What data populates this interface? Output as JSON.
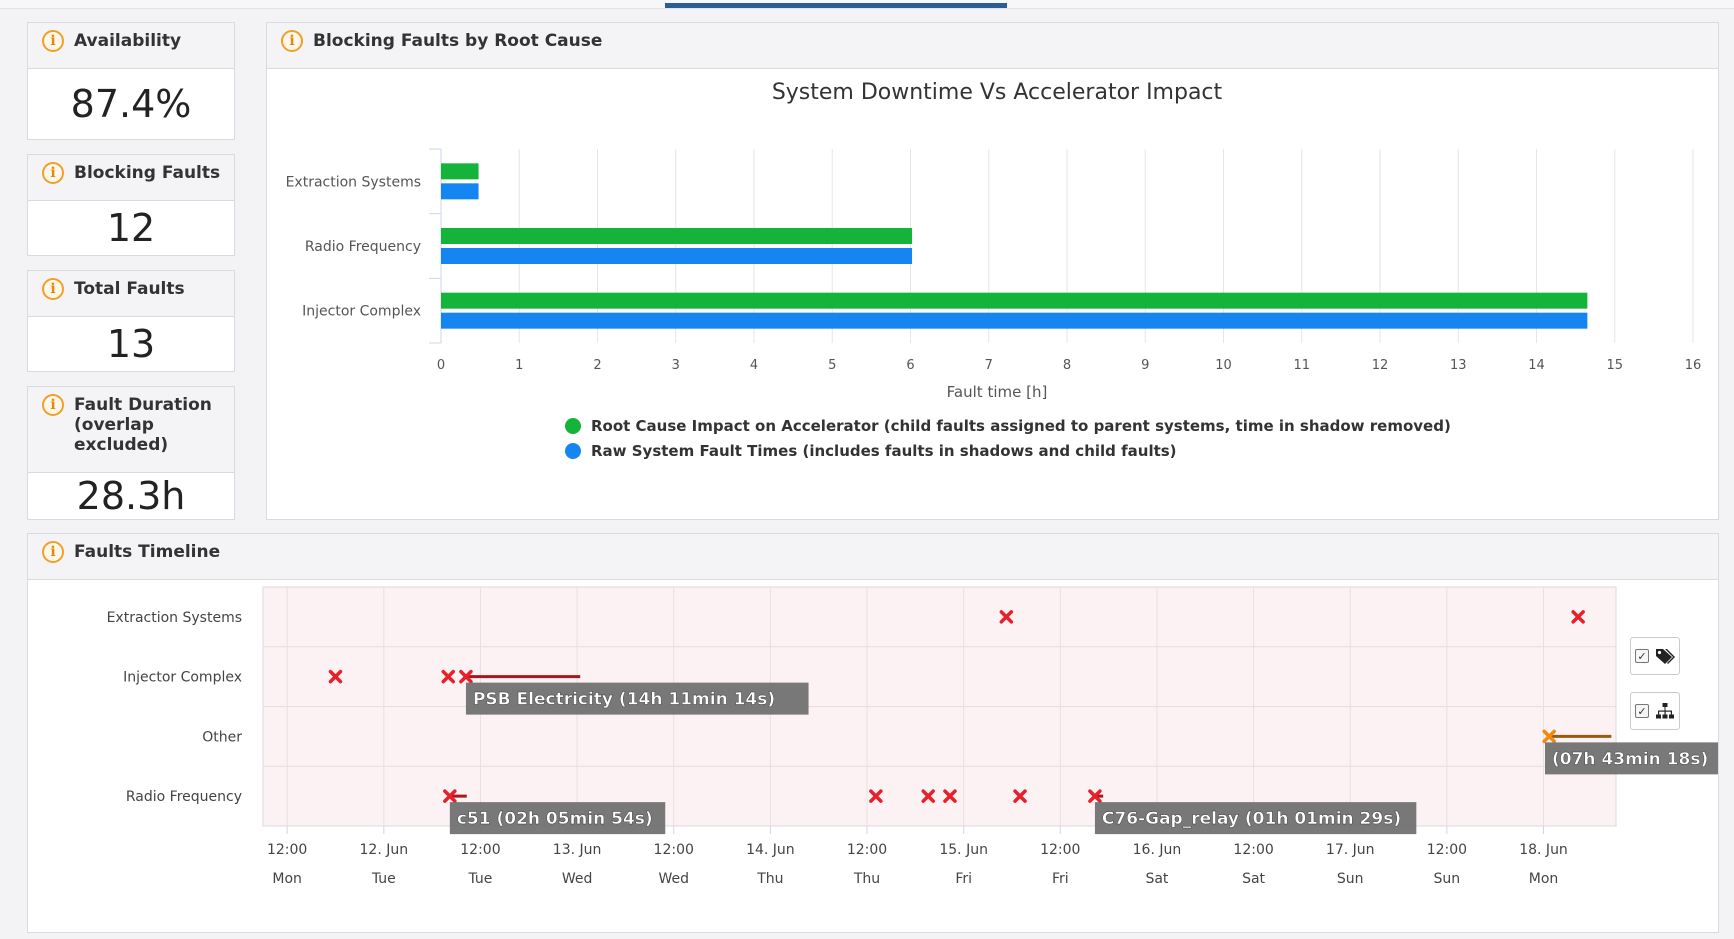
{
  "stats": [
    {
      "title": "Availability",
      "value": "87.4%"
    },
    {
      "title": "Blocking Faults",
      "value": "12"
    },
    {
      "title": "Total Faults",
      "value": "13"
    },
    {
      "title": "Fault Duration (overlap excluded)",
      "value": "28.3h"
    }
  ],
  "blocking_panel": {
    "title": "Blocking Faults by Root Cause"
  },
  "timeline_panel": {
    "title": "Faults Timeline"
  },
  "chart_data": [
    {
      "type": "bar",
      "orientation": "horizontal",
      "title": "System Downtime Vs Accelerator Impact",
      "xlabel": "Fault time [h]",
      "categories": [
        "Extraction Systems",
        "Radio Frequency",
        "Injector Complex"
      ],
      "xlim": [
        0,
        16
      ],
      "xticks": [
        0,
        1,
        2,
        3,
        4,
        5,
        6,
        7,
        8,
        9,
        10,
        11,
        12,
        13,
        14,
        15,
        16
      ],
      "series": [
        {
          "name": "Root Cause Impact on Accelerator (child faults assigned to parent systems, time in shadow removed)",
          "color": "#14b43a",
          "values": [
            0.48,
            6.02,
            14.65
          ]
        },
        {
          "name": "Raw System Fault Times (includes faults in shadows and child faults)",
          "color": "#1585f2",
          "values": [
            0.48,
            6.02,
            14.65
          ]
        }
      ],
      "legend": "bottom-center"
    },
    {
      "type": "scatter",
      "title": "",
      "categories": [
        "Extraction Systems",
        "Injector Complex",
        "Other",
        "Radio Frequency"
      ],
      "ticks": [
        {
          "top": "12:00",
          "bottom": "Mon"
        },
        {
          "top": "12. Jun",
          "bottom": "Tue"
        },
        {
          "top": "12:00",
          "bottom": "Tue"
        },
        {
          "top": "13. Jun",
          "bottom": "Wed"
        },
        {
          "top": "12:00",
          "bottom": "Wed"
        },
        {
          "top": "14. Jun",
          "bottom": "Thu"
        },
        {
          "top": "12:00",
          "bottom": "Thu"
        },
        {
          "top": "15. Jun",
          "bottom": "Fri"
        },
        {
          "top": "12:00",
          "bottom": "Fri"
        },
        {
          "top": "16. Jun",
          "bottom": "Sat"
        },
        {
          "top": "12:00",
          "bottom": "Sat"
        },
        {
          "top": "17. Jun",
          "bottom": "Sun"
        },
        {
          "top": "12:00",
          "bottom": "Sun"
        },
        {
          "top": "18. Jun",
          "bottom": "Mon"
        }
      ],
      "tick_hours": [
        -12,
        0,
        12,
        24,
        36,
        48,
        60,
        72,
        84,
        96,
        108,
        120,
        132,
        144
      ],
      "x_range_hours": [
        -15,
        153
      ],
      "x_unit": "hours from 12. Jun 00:00",
      "faults": [
        {
          "category": "Extraction Systems",
          "start": 77.3,
          "duration": 0,
          "color": "#e8202a"
        },
        {
          "category": "Extraction Systems",
          "start": 148.3,
          "duration": 0,
          "color": "#e8202a"
        },
        {
          "category": "Injector Complex",
          "start": -6.0,
          "duration": 0,
          "color": "#e8202a"
        },
        {
          "category": "Injector Complex",
          "start": 8.0,
          "duration": 0,
          "color": "#e8202a"
        },
        {
          "category": "Injector Complex",
          "start": 10.2,
          "duration": 14.19,
          "color": "#e8202a",
          "label": "PSB Electricity (14h 11min 14s)"
        },
        {
          "category": "Other",
          "start": 144.7,
          "duration": 7.72,
          "color": "#f08a10",
          "label": "(07h 43min 18s)"
        },
        {
          "category": "Radio Frequency",
          "start": 8.2,
          "duration": 2.1,
          "color": "#e8202a",
          "label": "c51 (02h 05min 54s)"
        },
        {
          "category": "Radio Frequency",
          "start": 61.1,
          "duration": 0,
          "color": "#e8202a"
        },
        {
          "category": "Radio Frequency",
          "start": 67.6,
          "duration": 0,
          "color": "#e8202a"
        },
        {
          "category": "Radio Frequency",
          "start": 70.3,
          "duration": 0,
          "color": "#e8202a"
        },
        {
          "category": "Radio Frequency",
          "start": 79.0,
          "duration": 0,
          "color": "#e8202a"
        },
        {
          "category": "Radio Frequency",
          "start": 88.3,
          "duration": 1.02,
          "color": "#e8202a",
          "label": "C76-Gap_relay (01h 01min 29s)"
        }
      ]
    }
  ],
  "colors": {
    "accent": "#2a5d93",
    "info_icon": "#f0a02a",
    "plot_band": "#fdf2f3"
  },
  "icons": {
    "info": "info-icon",
    "labels_toggle": "tags-icon",
    "hierarchy_toggle": "sitemap-icon",
    "checkbox": "checkbox-icon"
  }
}
